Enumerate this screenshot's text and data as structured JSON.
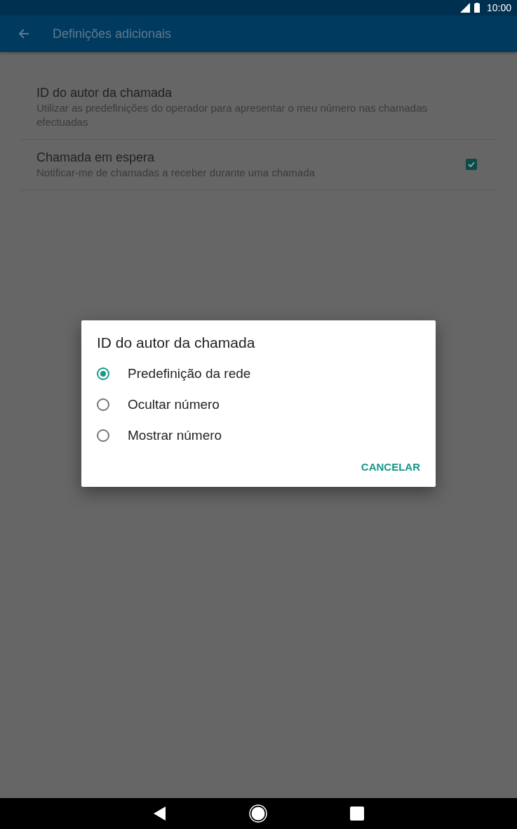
{
  "status_bar": {
    "time": "10:00"
  },
  "app_bar": {
    "title": "Definições adicionais"
  },
  "settings": [
    {
      "kind": "text",
      "title": "ID do autor da chamada",
      "summary": "Utilizar as predefinições do operador para apresentar o meu número nas chamadas efectuadas"
    },
    {
      "kind": "checkbox",
      "title": "Chamada em espera",
      "summary": "Notificar-me de chamadas a receber durante uma chamada",
      "checked": true
    }
  ],
  "dialog": {
    "title": "ID do autor da chamada",
    "options": [
      {
        "label": "Predefinição da rede",
        "selected": true
      },
      {
        "label": "Ocultar número",
        "selected": false
      },
      {
        "label": "Mostrar número",
        "selected": false
      }
    ],
    "buttons": [
      "CANCELAR"
    ]
  }
}
